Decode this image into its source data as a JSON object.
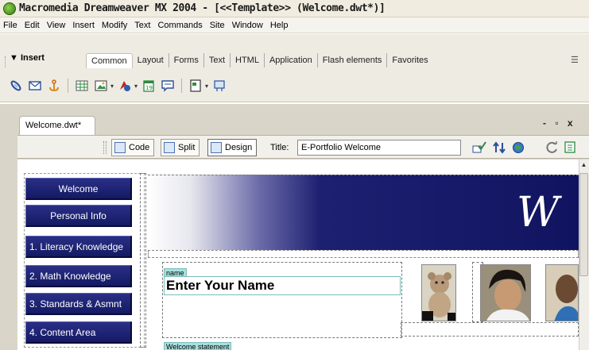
{
  "window": {
    "title": "Macromedia Dreamweaver MX 2004 - [<<Template>> (Welcome.dwt*)]"
  },
  "menu": [
    "File",
    "Edit",
    "View",
    "Insert",
    "Modify",
    "Text",
    "Commands",
    "Site",
    "Window",
    "Help"
  ],
  "insert_bar": {
    "title": "▼ Insert",
    "tabs": [
      "Common",
      "Layout",
      "Forms",
      "Text",
      "HTML",
      "Application",
      "Flash elements",
      "Favorites"
    ],
    "active_tab": "Common",
    "icons": [
      "hyperlink-icon",
      "email-link-icon",
      "named-anchor-icon",
      "table-icon",
      "image-icon",
      "media-icon",
      "date-icon",
      "comment-icon",
      "templates-icon",
      "tag-chooser-icon"
    ]
  },
  "document": {
    "tab_label": "Welcome.dwt*",
    "window_controls": "- ▫ x",
    "view_buttons": {
      "code": "Code",
      "split": "Split",
      "design": "Design"
    },
    "title_label": "Title:",
    "title_value": "E-Portfolio Welcome"
  },
  "page": {
    "nav": [
      "Welcome",
      "Personal Info",
      "1. Literacy Knowledge",
      "2. Math Knowledge",
      "3. Standards & Asmnt",
      "4. Content Area"
    ],
    "banner_text": "W",
    "name_tag": "name",
    "name_placeholder": "Enter Your Name",
    "welcome_tag": "Welcome statement"
  },
  "colors": {
    "nav_button": "#1c2170",
    "banner_dark": "#101460",
    "editable_tag": "#a8e0de"
  }
}
